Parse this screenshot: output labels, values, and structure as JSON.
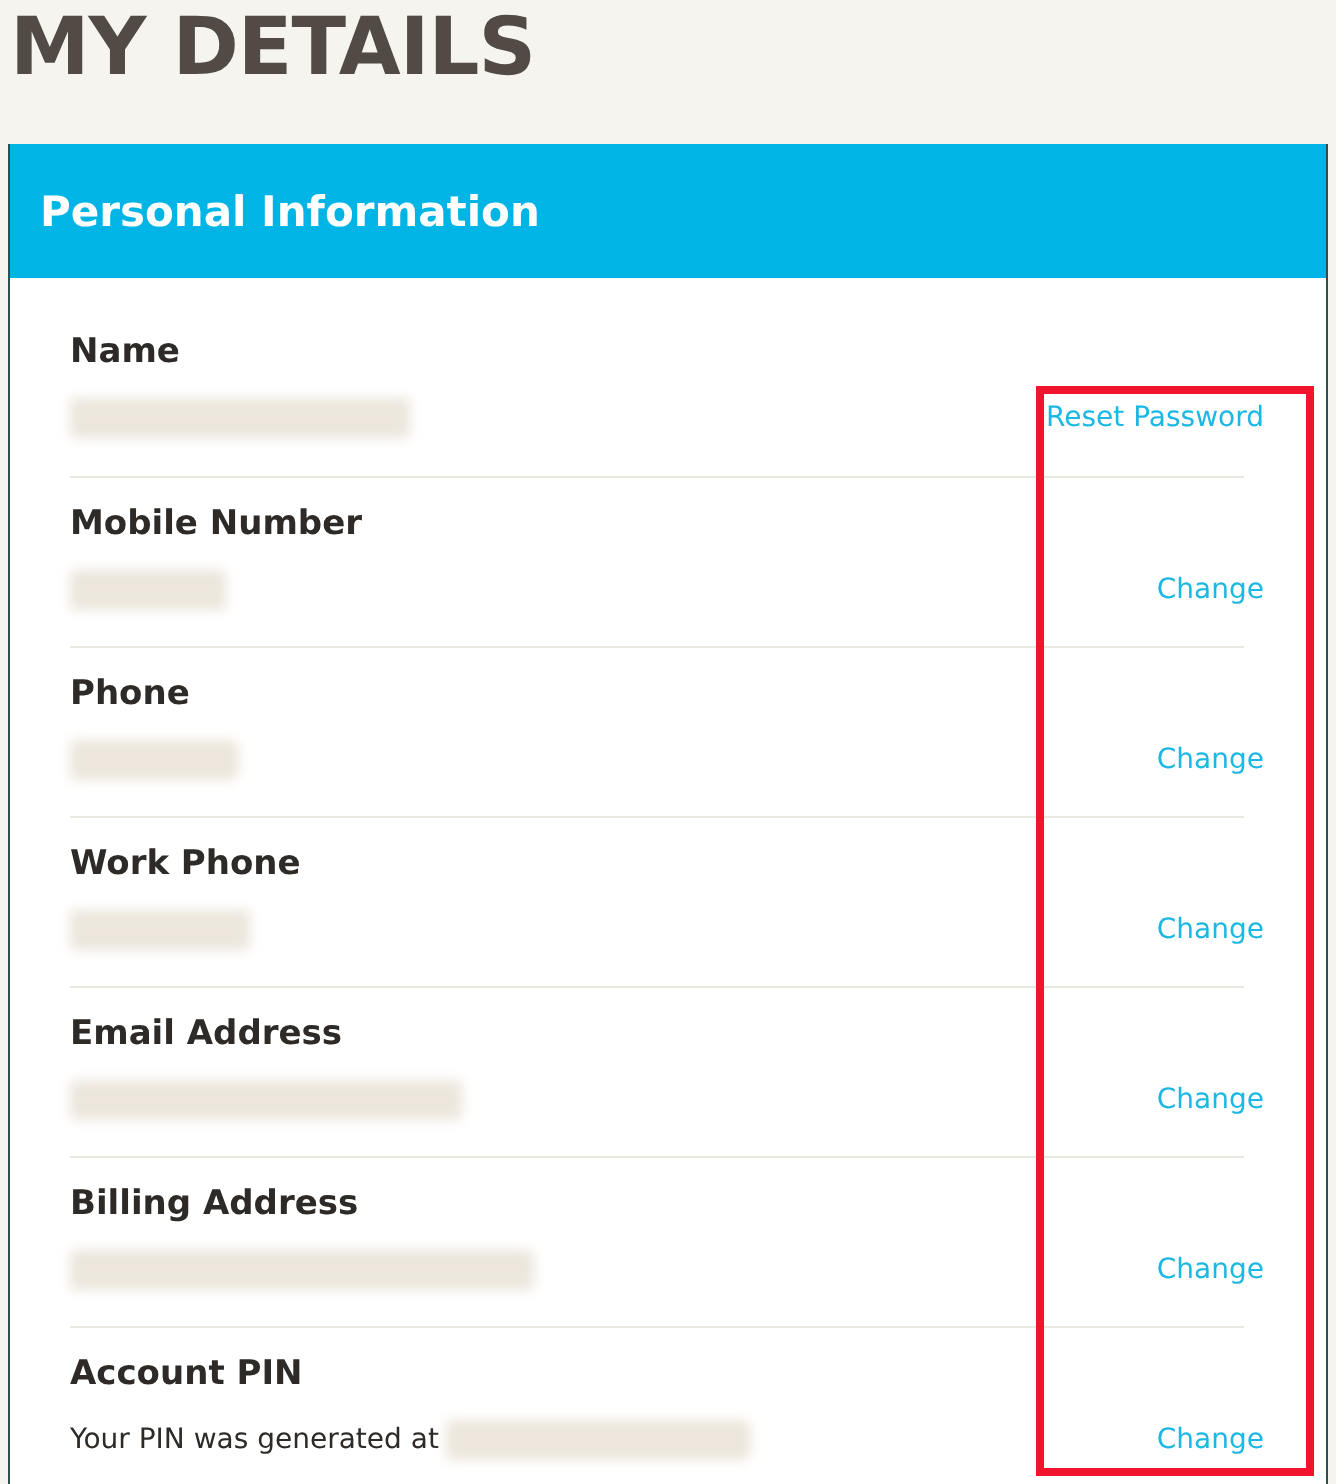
{
  "page_title": "MY DETAILS",
  "panel": {
    "title": "Personal Information",
    "rows": [
      {
        "label": "Name",
        "link": "Reset Password"
      },
      {
        "label": "Mobile Number",
        "link": "Change"
      },
      {
        "label": "Phone",
        "link": "Change"
      },
      {
        "label": "Work Phone",
        "link": "Change"
      },
      {
        "label": "Email Address",
        "link": "Change"
      },
      {
        "label": "Billing Address",
        "link": "Change"
      },
      {
        "label": "Account PIN",
        "note": "Your PIN was generated at",
        "link": "Change"
      }
    ]
  }
}
